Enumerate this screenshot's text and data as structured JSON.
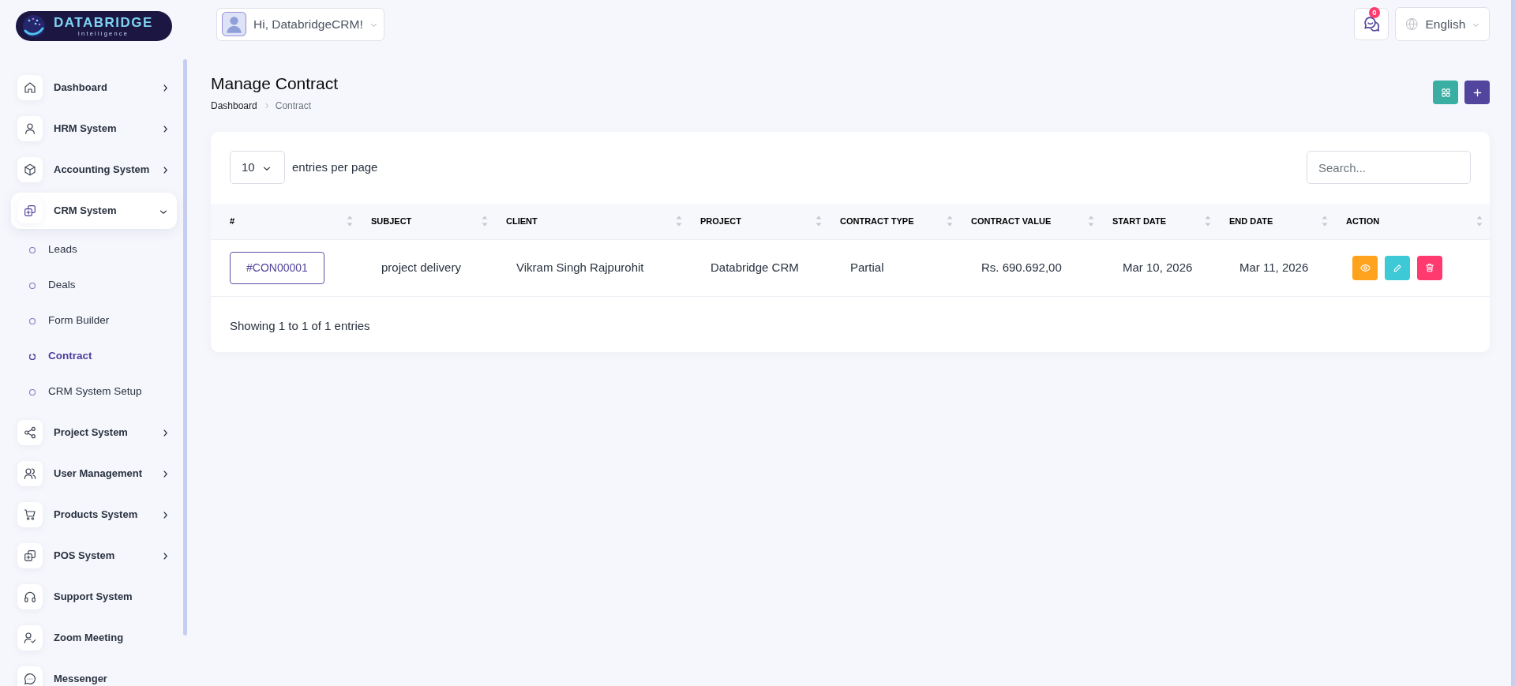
{
  "header": {
    "logo": {
      "name": "DATABRIDGE",
      "tagline": "Intelligence"
    },
    "user_menu": {
      "greeting": "Hi, DatabridgeCRM!"
    },
    "notifications": {
      "count": "0"
    },
    "language": {
      "label": "English"
    }
  },
  "sidebar": {
    "items": [
      {
        "label": "Dashboard",
        "kind": "group",
        "expanded": false,
        "selected": false
      },
      {
        "label": "HRM System",
        "kind": "group",
        "expanded": false,
        "selected": false
      },
      {
        "label": "Accounting System",
        "kind": "group",
        "expanded": false,
        "selected": false
      },
      {
        "label": "CRM System",
        "kind": "group",
        "expanded": true,
        "selected": true,
        "children": [
          {
            "label": "Leads",
            "selected": false
          },
          {
            "label": "Deals",
            "selected": false
          },
          {
            "label": "Form Builder",
            "selected": false
          },
          {
            "label": "Contract",
            "selected": true
          },
          {
            "label": "CRM System Setup",
            "selected": false
          }
        ]
      },
      {
        "label": "Project System",
        "kind": "group",
        "expanded": false,
        "selected": false
      },
      {
        "label": "User Management",
        "kind": "group",
        "expanded": false,
        "selected": false
      },
      {
        "label": "Products System",
        "kind": "group",
        "expanded": false,
        "selected": false
      },
      {
        "label": "POS System",
        "kind": "group",
        "expanded": false,
        "selected": false
      },
      {
        "label": "Support System",
        "kind": "link",
        "selected": false
      },
      {
        "label": "Zoom Meeting",
        "kind": "link",
        "selected": false
      },
      {
        "label": "Messenger",
        "kind": "link",
        "selected": false
      }
    ]
  },
  "page": {
    "title": "Manage Contract",
    "breadcrumb": [
      {
        "label": "Dashboard"
      },
      {
        "label": "Contract"
      }
    ]
  },
  "table": {
    "page_size": "10",
    "page_size_label": "entries per page",
    "search": {
      "placeholder": "Search..."
    },
    "columns": [
      {
        "label": "#"
      },
      {
        "label": "SUBJECT"
      },
      {
        "label": "CLIENT"
      },
      {
        "label": "PROJECT"
      },
      {
        "label": "CONTRACT TYPE"
      },
      {
        "label": "CONTRACT VALUE"
      },
      {
        "label": "START DATE"
      },
      {
        "label": "END DATE"
      },
      {
        "label": "ACTION"
      }
    ],
    "rows": [
      {
        "cells": [
          "#CON00001",
          "project delivery",
          "Vikram Singh Rajpurohit",
          "Databridge CRM",
          "Partial",
          "Rs. 690.692,00",
          "Mar 10, 2026",
          "Mar 11, 2026"
        ]
      }
    ],
    "footer": "Showing 1 to 1 of 1 entries"
  }
}
